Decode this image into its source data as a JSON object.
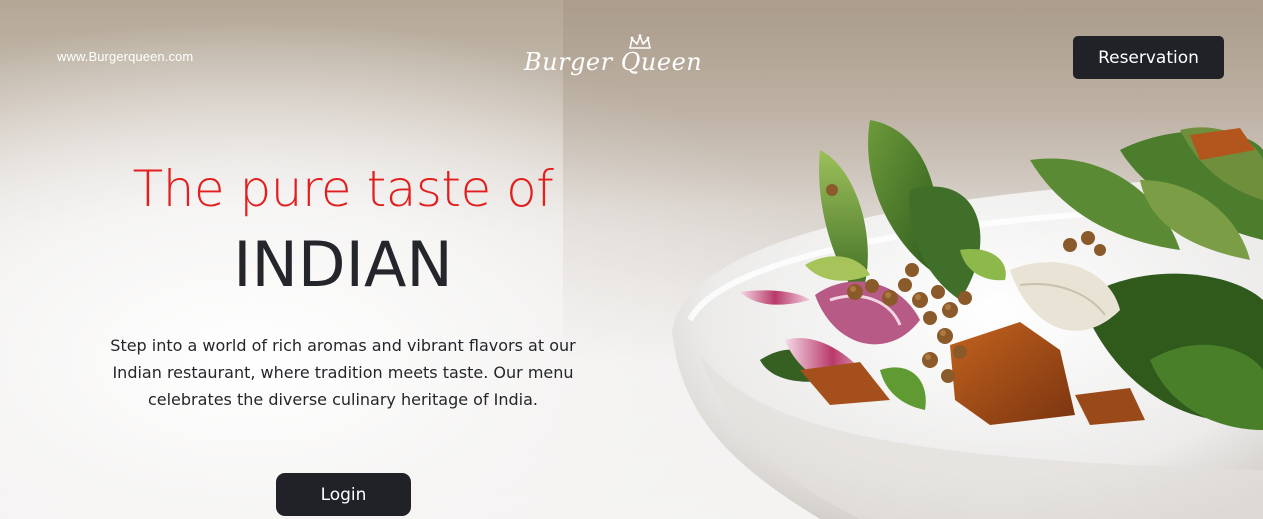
{
  "header": {
    "site_url": "www.Burgerqueen.com",
    "logo_text": "Burger Queen",
    "logo_icon": "crown-icon",
    "reservation_label": "Reservation"
  },
  "hero": {
    "title": "The pure taste of",
    "subtitle": "INDIAN",
    "description": "Step into a world of rich aromas and vibrant flavors at our Indian restaurant, where tradition meets taste. Our menu celebrates the diverse culinary heritage of India.",
    "login_label": "Login"
  },
  "colors": {
    "accent_red": "#e31e1e",
    "button_dark": "#202227",
    "text_dark": "#25262b"
  },
  "image": {
    "subject": "salad-bowl-photo"
  }
}
